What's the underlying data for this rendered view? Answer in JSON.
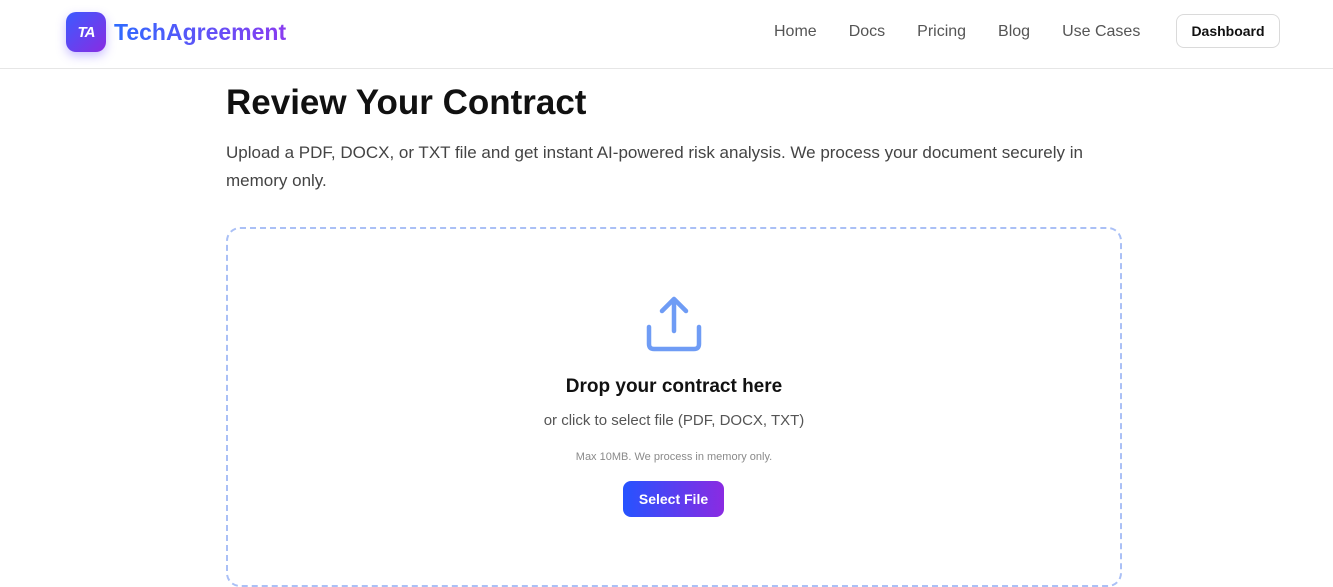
{
  "brand": {
    "logo_mark": "TA",
    "name": "TechAgreement",
    "gradient": [
      "#2f6bff",
      "#8a3cf0"
    ]
  },
  "nav": {
    "items": [
      "Home",
      "Docs",
      "Pricing",
      "Blog",
      "Use Cases"
    ],
    "dashboard_label": "Dashboard"
  },
  "main": {
    "title": "Review Your Contract",
    "description": "Upload a PDF, DOCX, or TXT file and get instant AI-powered risk analysis. We process your document securely in memory only."
  },
  "dropzone": {
    "icon": "upload-icon",
    "title": "Drop your contract here",
    "subtitle": "or click to select file (PDF, DOCX, TXT)",
    "note": "Max 10MB. We process in memory only.",
    "button_label": "Select File",
    "border_color": "#aac0f6",
    "icon_color": "#6f9cf5"
  }
}
